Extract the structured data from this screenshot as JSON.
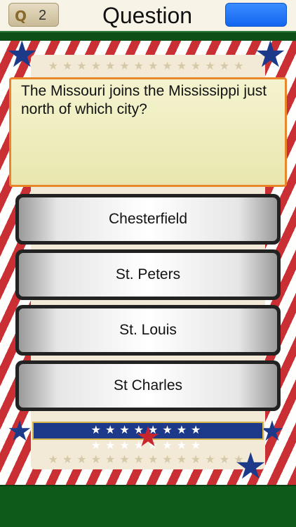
{
  "header": {
    "badge_letter": "Q",
    "question_number": "2",
    "title": "Question"
  },
  "question": {
    "text": "The Missouri joins the Mississippi just north of which city?"
  },
  "answers": [
    {
      "label": "Chesterfield"
    },
    {
      "label": "St. Peters"
    },
    {
      "label": "St. Louis"
    },
    {
      "label": "St Charles"
    }
  ],
  "colors": {
    "header_bg": "#f7f3e6",
    "green_bar": "#0d4f16",
    "question_border": "#e7862b",
    "button_blue": "#1466f0",
    "stripe_red": "#c8252c",
    "navy": "#1d3a8a"
  }
}
